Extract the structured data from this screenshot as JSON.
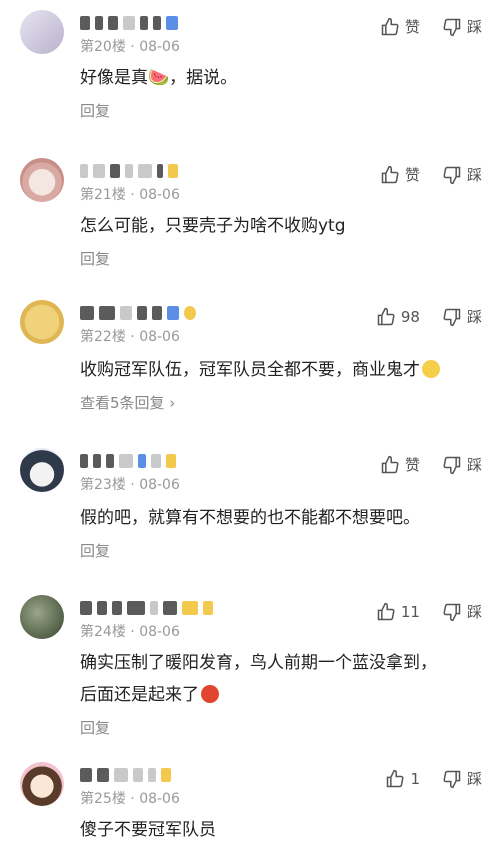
{
  "comments": [
    {
      "floor": "第20楼",
      "date": "08-06",
      "text": "好像是真🍉，据说。",
      "like": "赞",
      "dislike": "踩",
      "reply": "回复"
    },
    {
      "floor": "第21楼",
      "date": "08-06",
      "text": "怎么可能，只要壳子为啥不收购ytg",
      "like": "赞",
      "dislike": "踩",
      "reply": "回复"
    },
    {
      "floor": "第22楼",
      "date": "08-06",
      "text": "收购冠军队伍，冠军队员全都不要，商业鬼才",
      "like": "98",
      "dislike": "踩",
      "reply": "查看5条回复 ›"
    },
    {
      "floor": "第23楼",
      "date": "08-06",
      "text": "假的吧，就算有不想要的也不能都不想要吧。",
      "like": "赞",
      "dislike": "踩",
      "reply": "回复"
    },
    {
      "floor": "第24楼",
      "date": "08-06",
      "text": "确实压制了暖阳发育，鸟人前期一个蓝没拿到，",
      "text2": "后面还是起来了",
      "like": "11",
      "dislike": "踩",
      "reply": "回复"
    },
    {
      "floor": "第25楼",
      "date": "08-06",
      "text": "傻子不要冠军队员",
      "like": "1",
      "dislike": "踩",
      "reply": ""
    }
  ],
  "colors": {
    "meta": "#999999",
    "text": "#222222"
  }
}
